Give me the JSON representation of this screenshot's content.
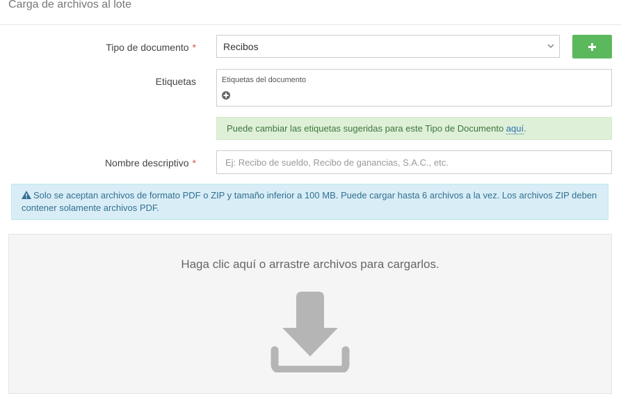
{
  "header": {
    "title": "Carga de archivos al lote"
  },
  "form": {
    "doc_type": {
      "label": "Tipo de documento",
      "required_mark": "*",
      "selected": "Recibos",
      "add_button_label": "+"
    },
    "tags": {
      "label": "Etiquetas",
      "box_title": "Etiquetas del documento"
    },
    "tags_notice": {
      "text": "Puede cambiar las etiquetas sugeridas para este Tipo de Documento ",
      "link": "aquí",
      "suffix": "."
    },
    "name": {
      "label": "Nombre descriptivo",
      "required_mark": "*",
      "value": "",
      "placeholder": "Ej: Recibo de sueldo, Recibo de ganancias, S.A.C., etc."
    }
  },
  "info_alert": {
    "text": "Solo se aceptan archivos de formato PDF o ZIP y tamaño inferior a 100 MB. Puede cargar hasta 6 archivos a la vez. Los archivos ZIP deben contener solamente archivos PDF."
  },
  "dropzone": {
    "text": "Haga clic aquí o arrastre archivos para cargarlos.",
    "icon": "download-icon"
  },
  "colors": {
    "success_button": "#5cb85c",
    "required": "#d9534f",
    "success_bg": "#dff0d8",
    "info_bg": "#d9edf7",
    "dropzone_icon": "#b5b5b5"
  }
}
